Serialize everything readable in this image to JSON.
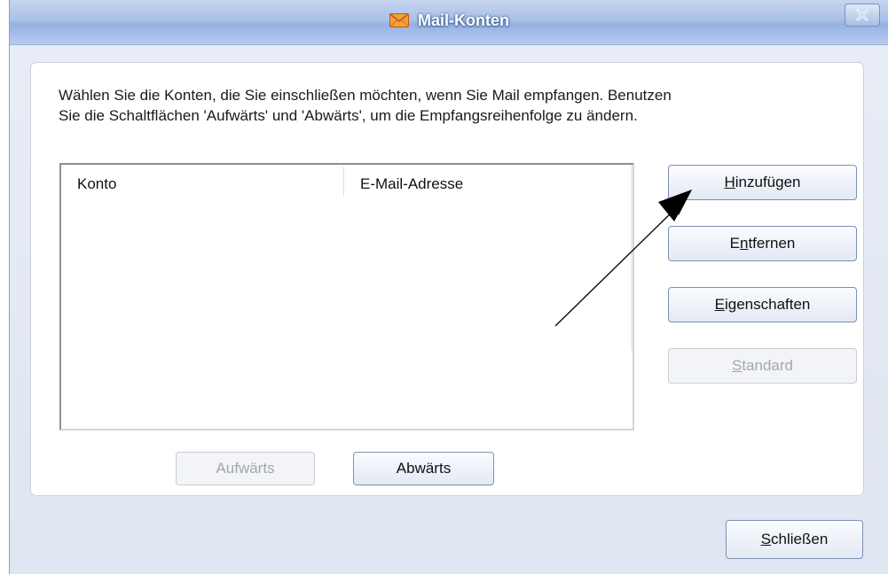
{
  "window": {
    "title": "Mail-Konten",
    "close_symbol": "×"
  },
  "description": {
    "line1": "Wählen Sie die Konten, die Sie einschließen möchten, wenn Sie Mail empfangen. Benutzen",
    "line2": "Sie die Schaltflächen 'Aufwärts' und 'Abwärts', um die Empfangsreihenfolge zu ändern."
  },
  "accounts_list": {
    "columns": [
      "Konto",
      "E-Mail-Adresse"
    ],
    "rows": []
  },
  "buttons": {
    "add": {
      "mnemonic": "H",
      "rest": "inzufügen"
    },
    "remove": {
      "mnemonic": "E",
      "rest": "ntfernen",
      "prefix": ""
    },
    "properties": {
      "mnemonic": "E",
      "rest": "igenschaften"
    },
    "default": {
      "mnemonic": "S",
      "rest": "tandard"
    },
    "up": "Aufwärts",
    "down": "Abwärts",
    "close": {
      "mnemonic": "S",
      "rest": "chließen"
    }
  },
  "remove_label_parts": {
    "first": "E",
    "underlined": "n",
    "rest": "tfernen"
  },
  "icons": {
    "title": "mail-envelope-icon",
    "close": "close-icon",
    "annotation": "arrow-annotation-icon"
  },
  "colors": {
    "titlebar": "#a9c0e8",
    "panel": "#ffffff",
    "button_border": "#7d8fb0",
    "disabled_text": "#a3a7ae"
  }
}
